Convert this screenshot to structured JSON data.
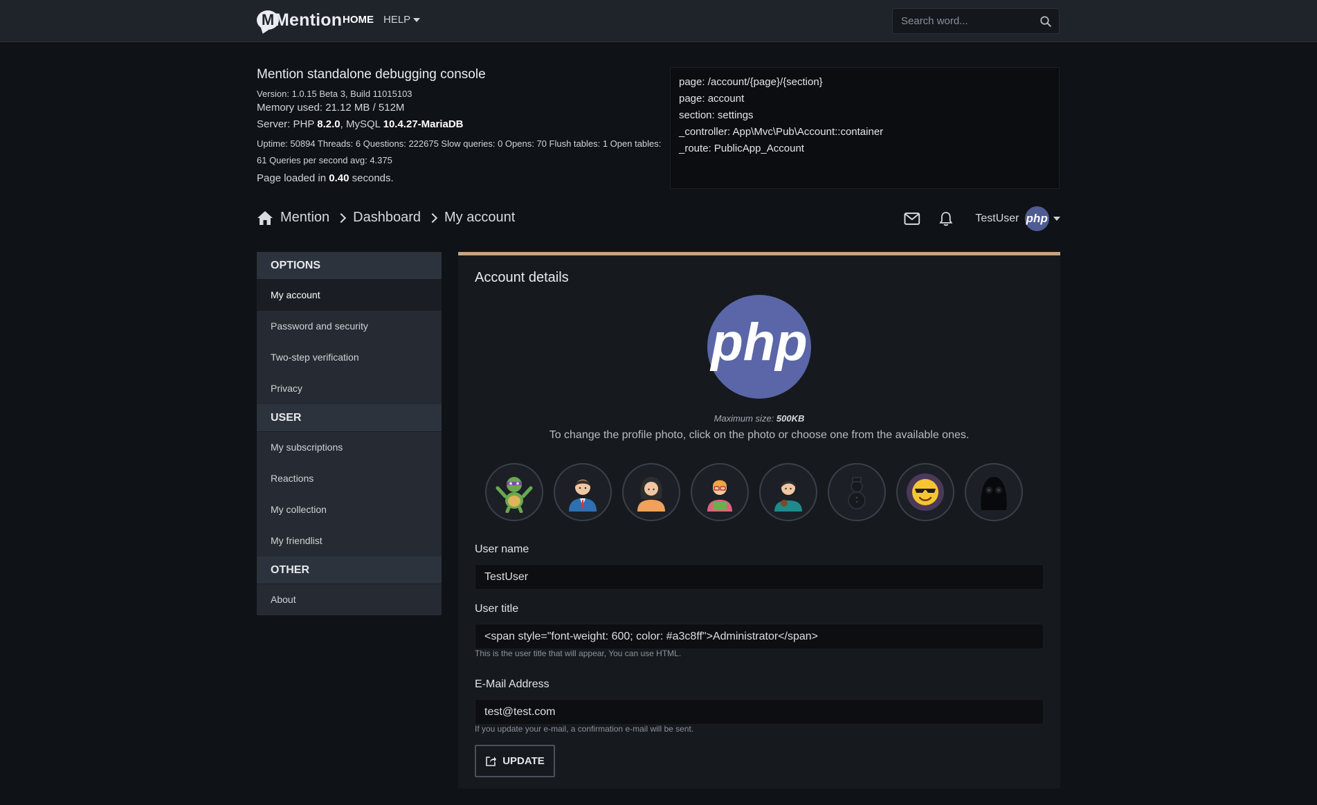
{
  "brand": {
    "logo_text": "Mention",
    "logo_letter": "M"
  },
  "nav": {
    "home": "HOME",
    "help": "HELP"
  },
  "search": {
    "placeholder": "Search word..."
  },
  "debug": {
    "title": "Mention standalone debugging console",
    "version": "Version: 1.0.15 Beta 3, Build 11015103",
    "memory": "Memory used: 21.12 MB / 512M",
    "server_prefix": "Server: PHP ",
    "php_version": "8.2.0",
    "mysql_prefix": ", MySQL ",
    "mysql_version": "10.4.27-MariaDB",
    "uptime": "Uptime: 50894 Threads: 6 Questions: 222675 Slow queries: 0 Opens: 70 Flush tables: 1 Open tables: 61 Queries per second avg: 4.375",
    "loaded_prefix": "Page loaded in ",
    "loaded_time": "0.40",
    "loaded_suffix": " seconds.",
    "route_lines": [
      "page: /account/{page}/{section}",
      "page: account",
      "section: settings",
      "_controller: App\\Mvc\\Pub\\Account::container",
      "_route: PublicApp_Account"
    ]
  },
  "breadcrumb": [
    "Mention",
    "Dashboard",
    "My account"
  ],
  "user": {
    "name": "TestUser",
    "avatar_text": "php"
  },
  "sidebar": {
    "sections": [
      {
        "title": "OPTIONS",
        "items": [
          "My account",
          "Password and security",
          "Two-step verification",
          "Privacy"
        ]
      },
      {
        "title": "USER",
        "items": [
          "My subscriptions",
          "Reactions",
          "My collection",
          "My friendlist"
        ]
      },
      {
        "title": "OTHER",
        "items": [
          "About"
        ]
      }
    ],
    "active": "My account"
  },
  "account": {
    "title": "Account details",
    "photo_text": "php",
    "max_size_label": "Maximum size: ",
    "max_size_value": "500KB",
    "change_text": "To change the profile photo, click on the photo or choose one from the available ones.",
    "avatars": [
      "turtle-avatar",
      "businessman-avatar",
      "woman-avatar",
      "glasses-man-avatar",
      "girl-avatar",
      "snowman-avatar",
      "sunglasses-smiley-avatar",
      "dark-mask-avatar"
    ],
    "username_label": "User name",
    "username_value": "TestUser",
    "usertitle_label": "User title",
    "usertitle_value": "<span style=\"font-weight: 600; color: #a3c8ff\">Administrator</span>",
    "usertitle_help": "This is the user title that will appear, You can use HTML.",
    "email_label": "E-Mail Address",
    "email_value": "test@test.com",
    "email_help": "If you update your e-mail, a confirmation e-mail will be sent.",
    "update_label": "UPDATE"
  },
  "colors": {
    "accent": "#c6a483",
    "php": "#5a66a7",
    "background": "#0f1216"
  }
}
